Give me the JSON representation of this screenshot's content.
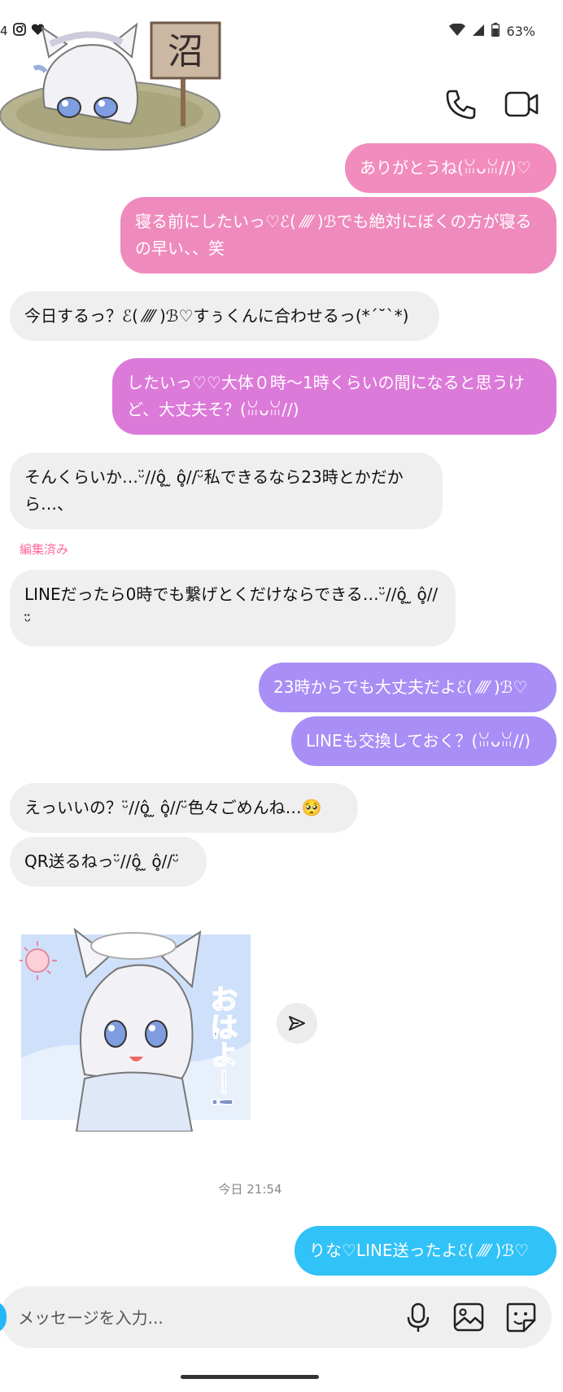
{
  "status_bar": {
    "time_fragment": "4",
    "battery": "63%"
  },
  "colors": {
    "pink": "#f28cbc",
    "magenta": "#dc7ad9",
    "purple": "#a88ef5",
    "cyan": "#31c2f7",
    "incoming": "#efefef"
  },
  "header": {
    "sign_text": "沼",
    "call_icon": "phone-icon",
    "video_icon": "video-camera-icon"
  },
  "messages": [
    {
      "dir": "out",
      "color": "pink",
      "text": "ありがとうね(ꈍᴗꈍ//)♡"
    },
    {
      "dir": "out",
      "color": "pink",
      "text": "寝る前にしたいっ♡ℰ( ⁄⁄⁄⁄ )ℬでも絶対にぼくの方が寝るの早い、、笑"
    },
    {
      "dir": "in",
      "text": "今日するっ？ℰ( ⁄⁄⁄⁄ )ℬ♡すぅくんに合わせるっ(*´˘`*)"
    },
    {
      "dir": "out",
      "color": "magenta",
      "text": "したいっ♡♡大体０時〜1時くらいの間になると思うけど、大丈夫そ？(ꈍᴗꈍ//)"
    },
    {
      "dir": "in",
      "text": "そんくらいか…ᵕ̈//ô̥ ̫ ô̥//ᵕ̈私できるなら23時とかだから…、"
    },
    {
      "dir": "in",
      "text": "LINEだったら0時でも繋げとくだけならできる…ᵕ̈//ô̥ ̫ ô̥//ᵕ̈",
      "edited": "編集済み"
    },
    {
      "dir": "out",
      "color": "purple",
      "text": "23時からでも大丈夫だよℰ( ⁄⁄⁄⁄ )ℬ♡"
    },
    {
      "dir": "out",
      "color": "purple",
      "text": "LINEも交換しておく？(ꈍᴗꈍ//)"
    },
    {
      "dir": "in",
      "text": "えっいいの？ᵕ̈//ô̥ ̫ ô̥//ᵕ̈色々ごめんね…🥺"
    },
    {
      "dir": "in",
      "text": "QR送るねっᵕ̈//ô̥ ̫ ô̥//ᵕ̈"
    },
    {
      "dir": "out",
      "color": "cyan",
      "text": "りな♡LINE送ったよℰ( ⁄⁄⁄⁄ )ℬ♡"
    }
  ],
  "sticker": {
    "text": "おはよー!",
    "share_icon": "send-icon"
  },
  "timestamp": "今日 21:54",
  "composer": {
    "placeholder": "メッセージを入力...",
    "mic_icon": "microphone-icon",
    "gallery_icon": "image-icon",
    "sticker_icon": "sticker-icon"
  }
}
